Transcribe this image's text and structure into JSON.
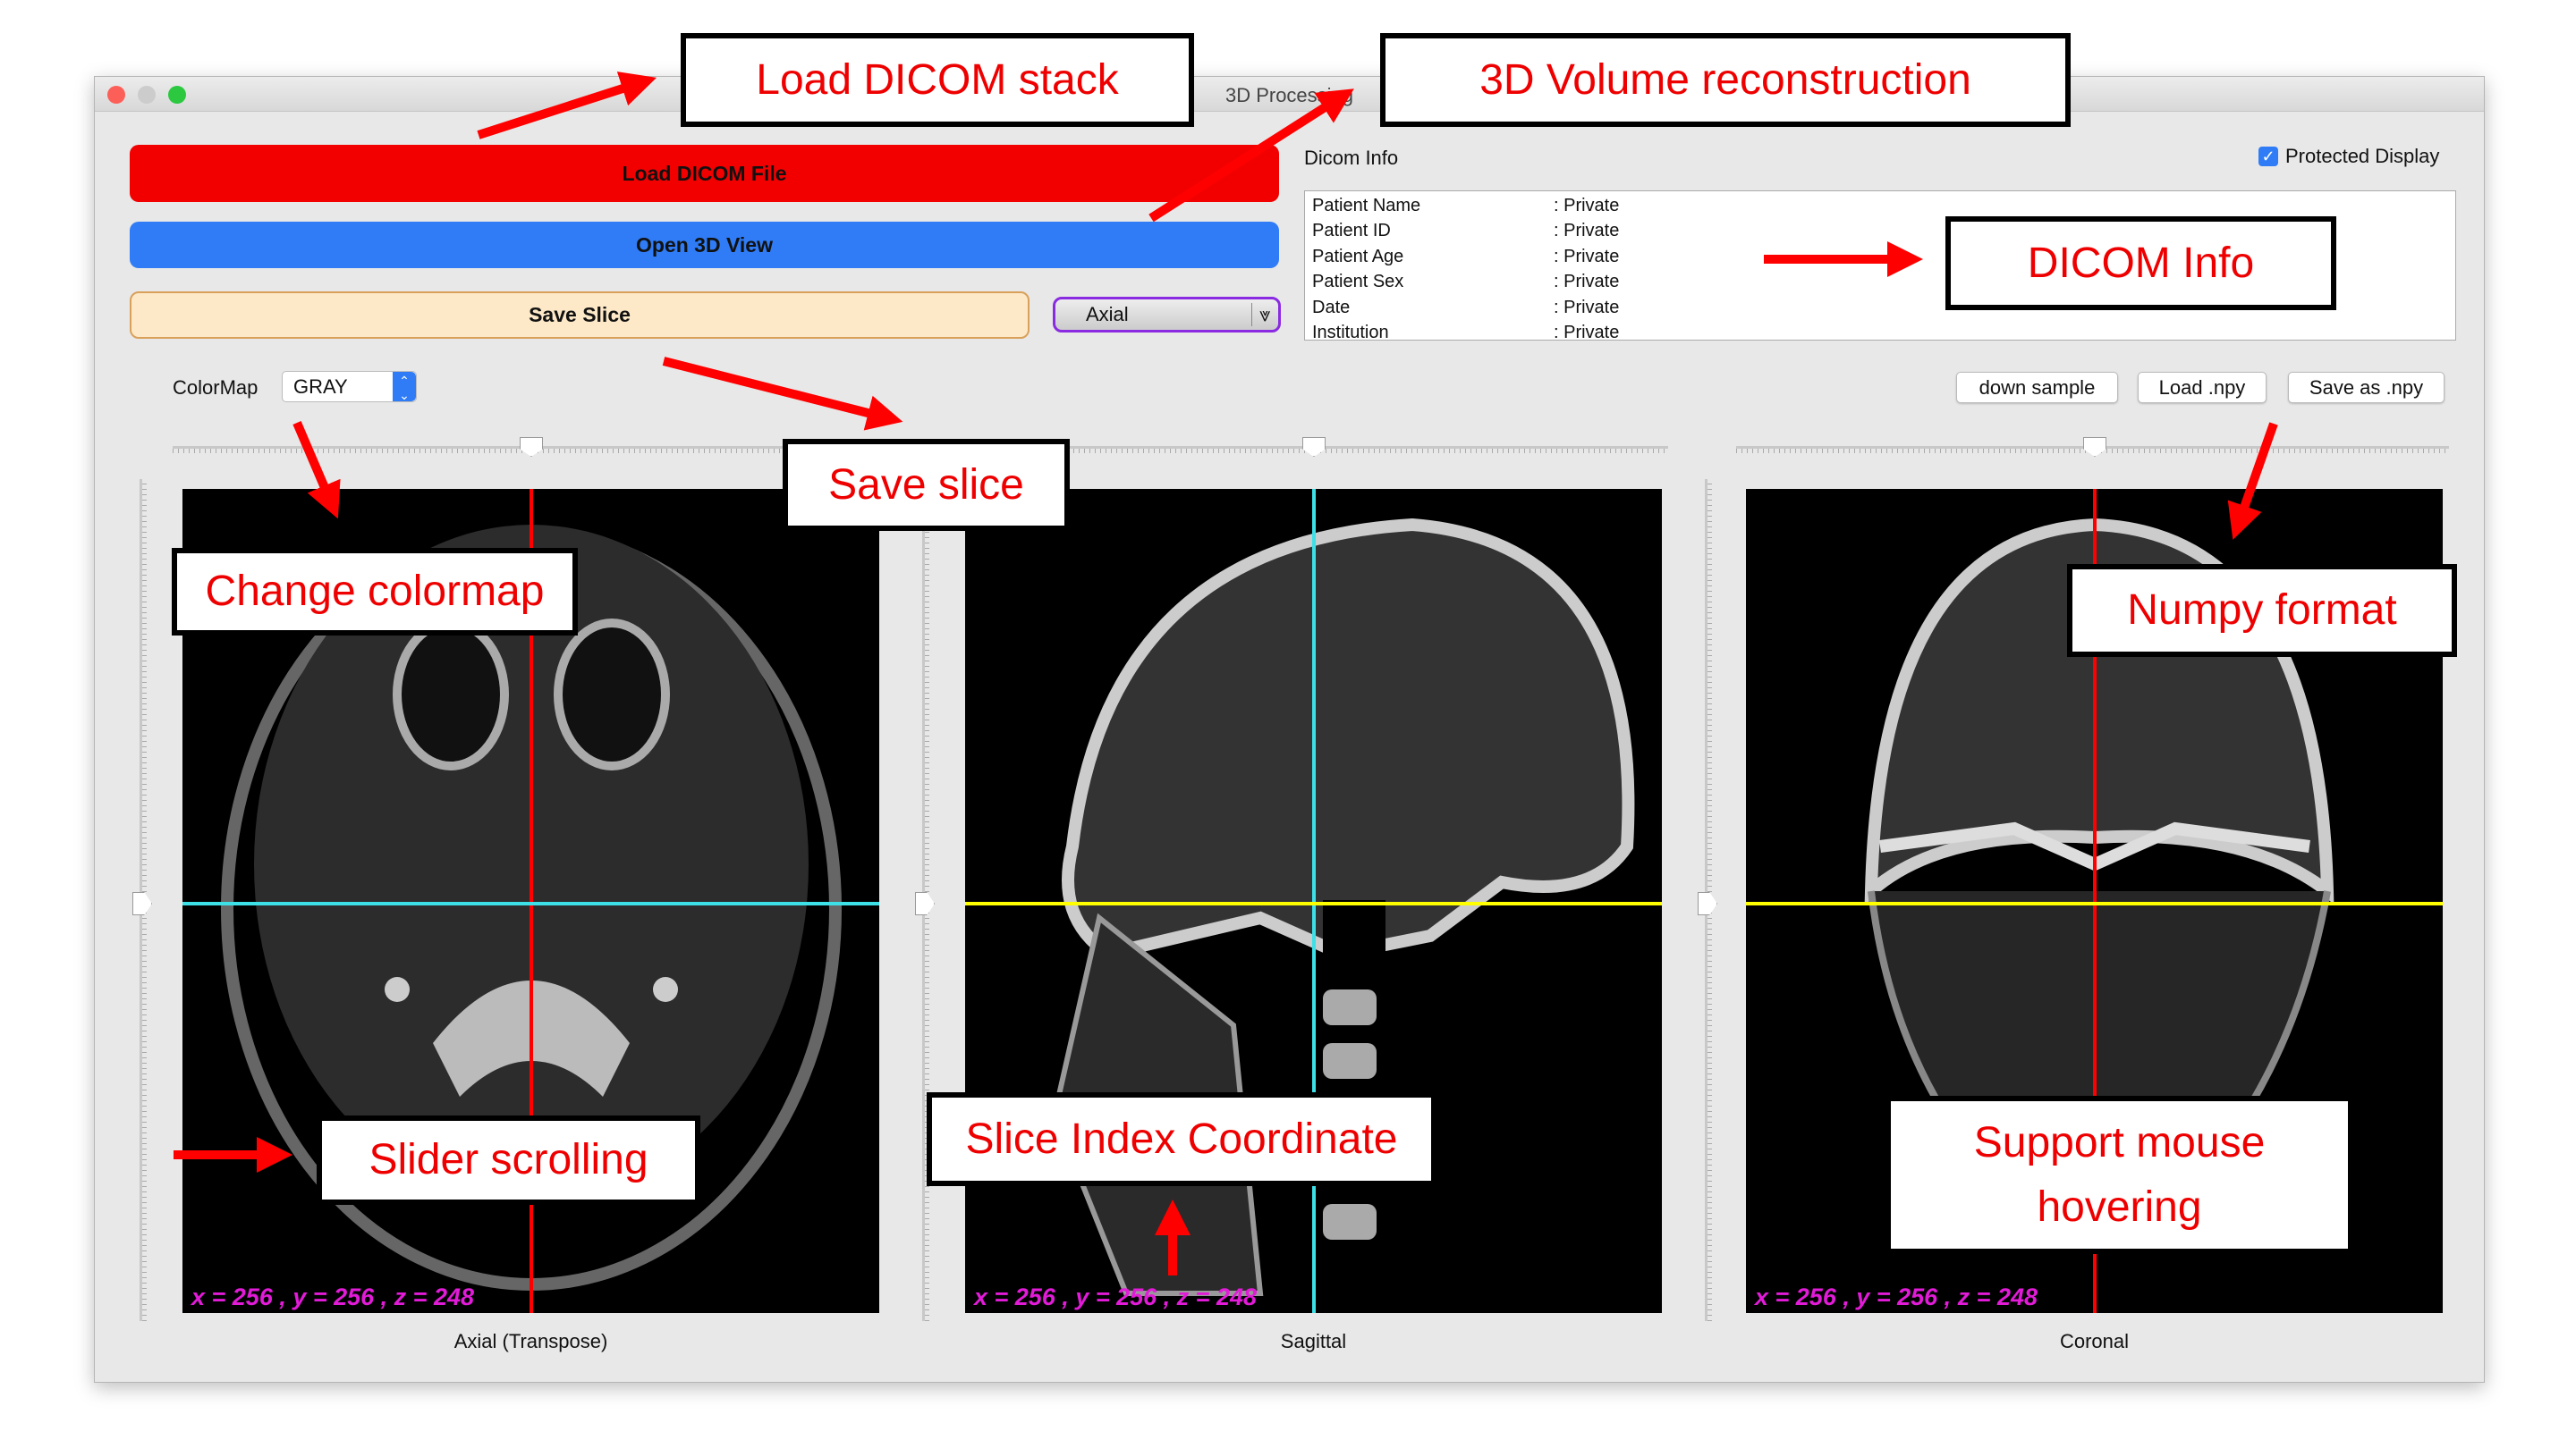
{
  "window": {
    "title": "3D Processing"
  },
  "buttons": {
    "load_dicom": "Load DICOM File",
    "open_3d": "Open 3D View",
    "save_slice": "Save Slice",
    "down_sample": "down sample",
    "load_npy": "Load .npy",
    "save_npy": "Save as .npy"
  },
  "view_select": {
    "value": "Axial"
  },
  "colormap": {
    "label": "ColorMap",
    "value": "GRAY"
  },
  "dicom_info": {
    "label": "Dicom Info",
    "protected_label": "Protected Display",
    "protected_checked": true,
    "rows": [
      {
        "key": "Patient Name",
        "value": ": Private"
      },
      {
        "key": "Patient ID",
        "value": ": Private"
      },
      {
        "key": "Patient Age",
        "value": ": Private"
      },
      {
        "key": "Patient Sex",
        "value": ": Private"
      },
      {
        "key": "Date",
        "value": ": Private"
      },
      {
        "key": "Institution",
        "value": ": Private"
      }
    ]
  },
  "panels": [
    {
      "label": "Axial (Transpose)",
      "coord": "x = 256 , y = 256 , z = 248"
    },
    {
      "label": "Sagittal",
      "coord": "x = 256 , y = 256 , z = 248"
    },
    {
      "label": "Coronal",
      "coord": "x = 256 , y = 256 , z = 248"
    }
  ],
  "annotations": {
    "load_stack": "Load DICOM stack",
    "volume": "3D Volume reconstruction",
    "dicom_info": "DICOM Info",
    "save_slice": "Save slice",
    "colormap": "Change colormap",
    "numpy": "Numpy format",
    "slider": "Slider scrolling",
    "coord": "Slice Index Coordinate",
    "hover_1": "Support mouse",
    "hover_2": "hovering"
  },
  "colors": {
    "load": "#f20000",
    "open3d": "#2f7cf6",
    "save": "#fde9c8",
    "crosshair_red": "#ff0000",
    "crosshair_cyan": "#3ee0e8",
    "crosshair_yellow": "#ffff00",
    "coord_text": "#e21bd8",
    "annotation": "#e00000"
  }
}
